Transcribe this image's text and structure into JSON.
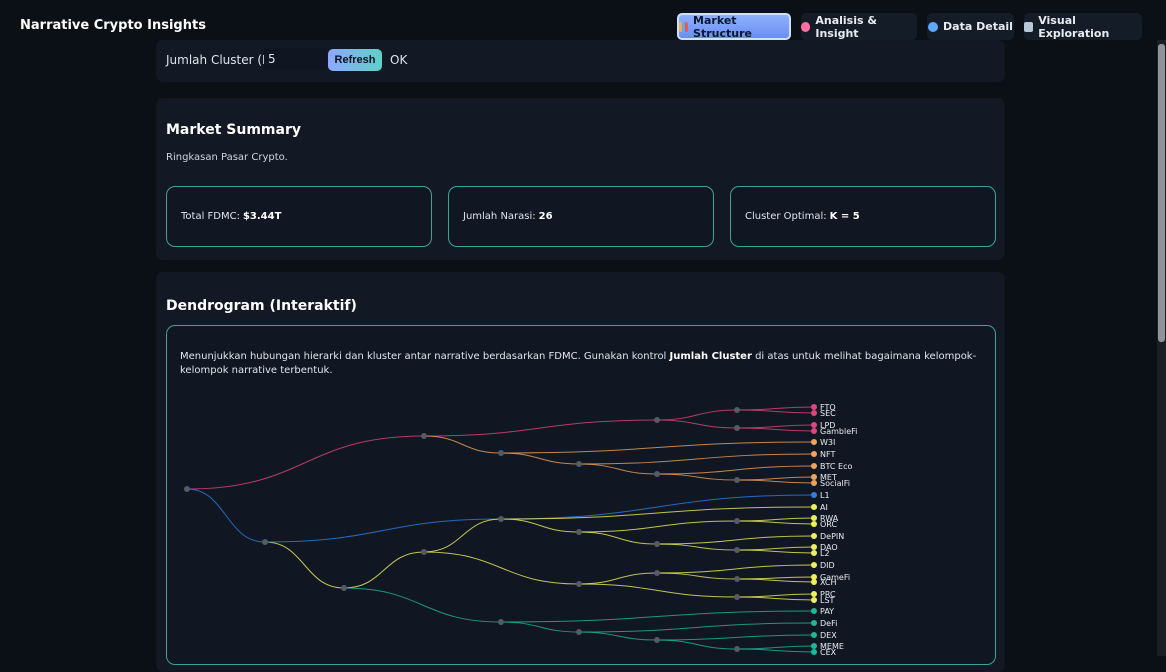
{
  "app": {
    "title": "Narrative Crypto Insights"
  },
  "nav": [
    {
      "label": "Market Structure",
      "active": true,
      "icon": "bar-chart-icon",
      "color": "#e8b24a"
    },
    {
      "label": "Analisis & Insight",
      "active": false,
      "icon": "brain-icon",
      "color": "#ff6fa3"
    },
    {
      "label": "Data Detail",
      "active": false,
      "icon": "magnifier-icon",
      "color": "#5fa8ff"
    },
    {
      "label": "Visual Exploration",
      "active": false,
      "icon": "chart-window-icon",
      "color": "#b9c6d8"
    }
  ],
  "controls": {
    "cluster_label": "Jumlah Cluster (K)",
    "cluster_value": "5",
    "refresh_label": "Refresh",
    "status": "OK"
  },
  "summary": {
    "title": "Market Summary",
    "subtitle": "Ringkasan Pasar Crypto.",
    "fdmc_label": "Total FDMC:",
    "fdmc_value": "$3.44T",
    "narasi_label": "Jumlah Narasi:",
    "narasi_value": "26",
    "cluster_label": "Cluster Optimal:",
    "cluster_value": "K = 5"
  },
  "dendrogram": {
    "title": "Dendrogram (Interaktif)",
    "desc_pre": "Menunjukkan hubungan hierarki dan kluster antar narrative berdasarkan FDMC. Gunakan kontrol ",
    "desc_bold": "Jumlah Cluster",
    "desc_post": " di atas untuk melihat bagaimana kelompok-kelompok narrative terbentuk.",
    "cluster_colors": {
      "pink": "#e0457b",
      "orange": "#f0a15a",
      "blue": "#2d7fe0",
      "yellow": "#eef05a",
      "teal": "#1fb79a"
    },
    "leaves": [
      {
        "label": "FTO",
        "cluster": "pink"
      },
      {
        "label": "SEC",
        "cluster": "pink"
      },
      {
        "label": "LPD",
        "cluster": "pink"
      },
      {
        "label": "GambleFi",
        "cluster": "pink"
      },
      {
        "label": "W3I",
        "cluster": "orange"
      },
      {
        "label": "NFT",
        "cluster": "orange"
      },
      {
        "label": "BTC Eco",
        "cluster": "orange"
      },
      {
        "label": "MET",
        "cluster": "orange"
      },
      {
        "label": "SocialFi",
        "cluster": "orange"
      },
      {
        "label": "L1",
        "cluster": "blue"
      },
      {
        "label": "AI",
        "cluster": "yellow"
      },
      {
        "label": "RWA",
        "cluster": "yellow"
      },
      {
        "label": "ORC",
        "cluster": "yellow"
      },
      {
        "label": "DePIN",
        "cluster": "yellow"
      },
      {
        "label": "DAO",
        "cluster": "yellow"
      },
      {
        "label": "L2",
        "cluster": "yellow"
      },
      {
        "label": "DID",
        "cluster": "yellow"
      },
      {
        "label": "GameFi",
        "cluster": "yellow"
      },
      {
        "label": "XCH",
        "cluster": "yellow"
      },
      {
        "label": "PRC",
        "cluster": "yellow"
      },
      {
        "label": "LST",
        "cluster": "yellow"
      },
      {
        "label": "PAY",
        "cluster": "teal"
      },
      {
        "label": "DeFi",
        "cluster": "teal"
      },
      {
        "label": "DEX",
        "cluster": "teal"
      },
      {
        "label": "MEME",
        "cluster": "teal"
      },
      {
        "label": "CEX",
        "cluster": "teal"
      }
    ]
  }
}
